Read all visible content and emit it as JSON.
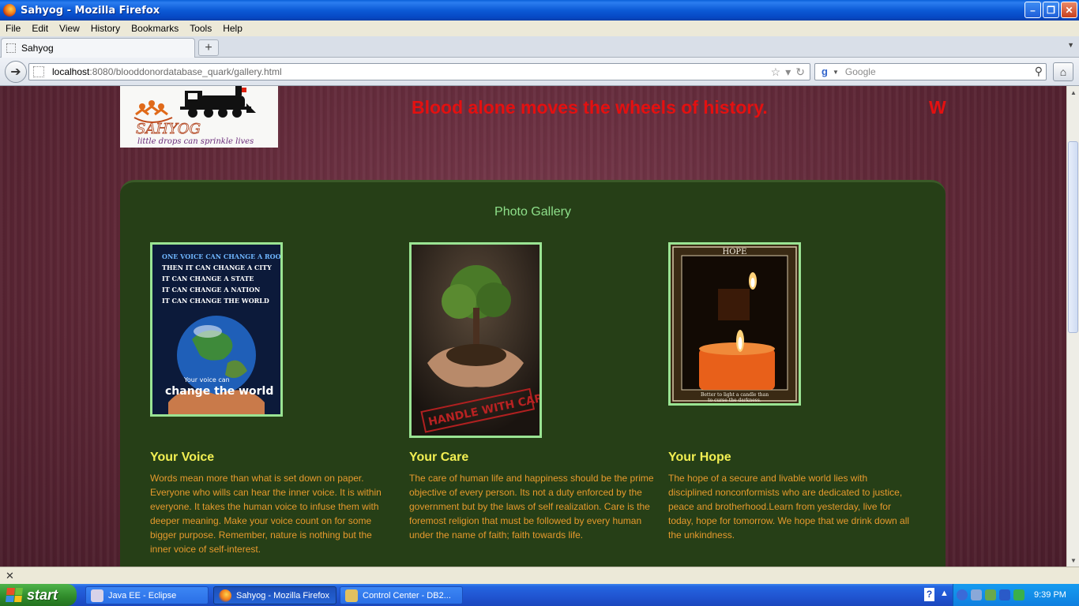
{
  "window": {
    "title": "Sahyog - Mozilla Firefox"
  },
  "menu": [
    "File",
    "Edit",
    "View",
    "History",
    "Bookmarks",
    "Tools",
    "Help"
  ],
  "tab": {
    "label": "Sahyog",
    "new_tab": "+"
  },
  "navbar": {
    "url_host": "localhost",
    "url_rest": ":8080/blooddonordatabase_quark/gallery.html",
    "search_placeholder": "Google"
  },
  "page": {
    "logo": {
      "brand": "SAHYOG",
      "tagline": "little drops can sprinkle lives"
    },
    "marquee_text": "Blood alone moves the wheels of history.",
    "marquee_next": "W",
    "gallery_title": "Photo Gallery",
    "items": [
      {
        "title": "Your Voice",
        "text": "Words mean more than what is set down on paper. Everyone who wills can hear the inner voice. It is within everyone. It takes the human voice to infuse them with deeper meaning. Make your voice count on for some bigger purpose. Remember, nature is nothing but the inner voice of self-interest.",
        "image_lines": [
          "ONE VOICE CAN CHANGE A ROOM",
          "THEN IT CAN CHANGE A CITY",
          "IT CAN CHANGE A STATE",
          "IT CAN CHANGE A NATION",
          "IT CAN CHANGE THE WORLD"
        ],
        "image_caption": [
          "Your voice can",
          "change the world"
        ]
      },
      {
        "title": "Your Care",
        "text": "The care of human life and happiness should be the prime objective of every person. Its not a duty enforced by the government but by the laws of self realization. Care is the foremost religion that must be followed by every human under the name of faith; faith towards life.",
        "image_stamp": "HANDLE WITH CARE"
      },
      {
        "title": "Your Hope",
        "text": "The hope of a secure and livable world lies with disciplined nonconformists who are dedicated to justice, peace and brotherhood.Learn from yesterday, live for today, hope for tomorrow. We hope that we drink down all the unkindness.",
        "image_header": "HOPE",
        "image_footer": [
          "Better to light a candle than",
          "to curse the darkness."
        ]
      }
    ]
  },
  "taskbar": {
    "start": "start",
    "tasks": [
      "Java EE - Eclipse",
      "Sahyog - Mozilla Firefox",
      "Control Center - DB2..."
    ],
    "clock": "9:39 PM"
  },
  "colors": {
    "marquee": "#e41010",
    "panel": "#263f17",
    "gallery_title": "#8ee08a",
    "caption_title": "#f2ef52",
    "caption_text": "#e69a2d"
  }
}
